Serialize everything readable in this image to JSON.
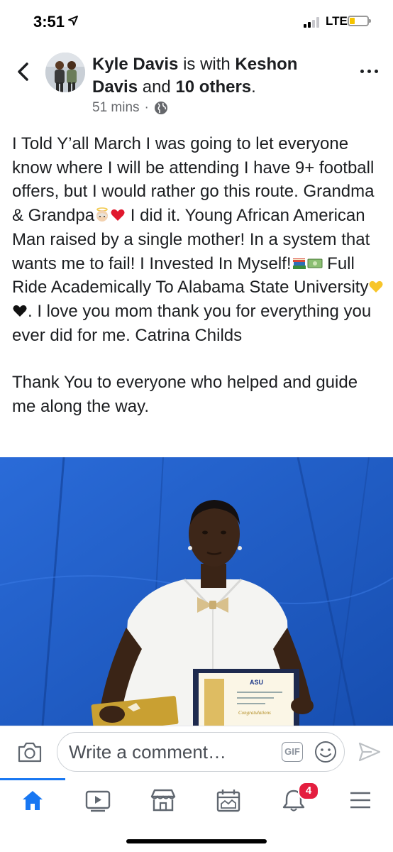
{
  "status_bar": {
    "time": "3:51",
    "network": "LTE"
  },
  "post": {
    "author": "Kyle Davis",
    "with_text": " is with ",
    "tagged_name": "Keshon Davis",
    "and_text": " and ",
    "others": "10 others",
    "period": ".",
    "time_ago": "51 mins",
    "body": {
      "p1_a": "I Told Y’all March I was going to let everyone know where I will be attending I have 9+ football offers, but I would rather go this route. Grandma & Grandpa",
      "p1_b": " I did it. Young African American Man raised by a single mother! In a system that wants me to fail!  I Invested In Myself!",
      "p1_c": " Full Ride Academically To Alabama State University",
      "p1_d": ". I love you mom thank you for everything you ever did for me. Catrina Childs",
      "p2": "Thank You to everyone who helped and guide me along the way."
    },
    "certificate": {
      "logo": "ASU",
      "heading": "Congratulations"
    }
  },
  "comment_bar": {
    "placeholder": "Write a comment…",
    "gif_label": "GIF"
  },
  "tab_bar": {
    "notifications_badge": "4",
    "accent": "#1877f2"
  }
}
